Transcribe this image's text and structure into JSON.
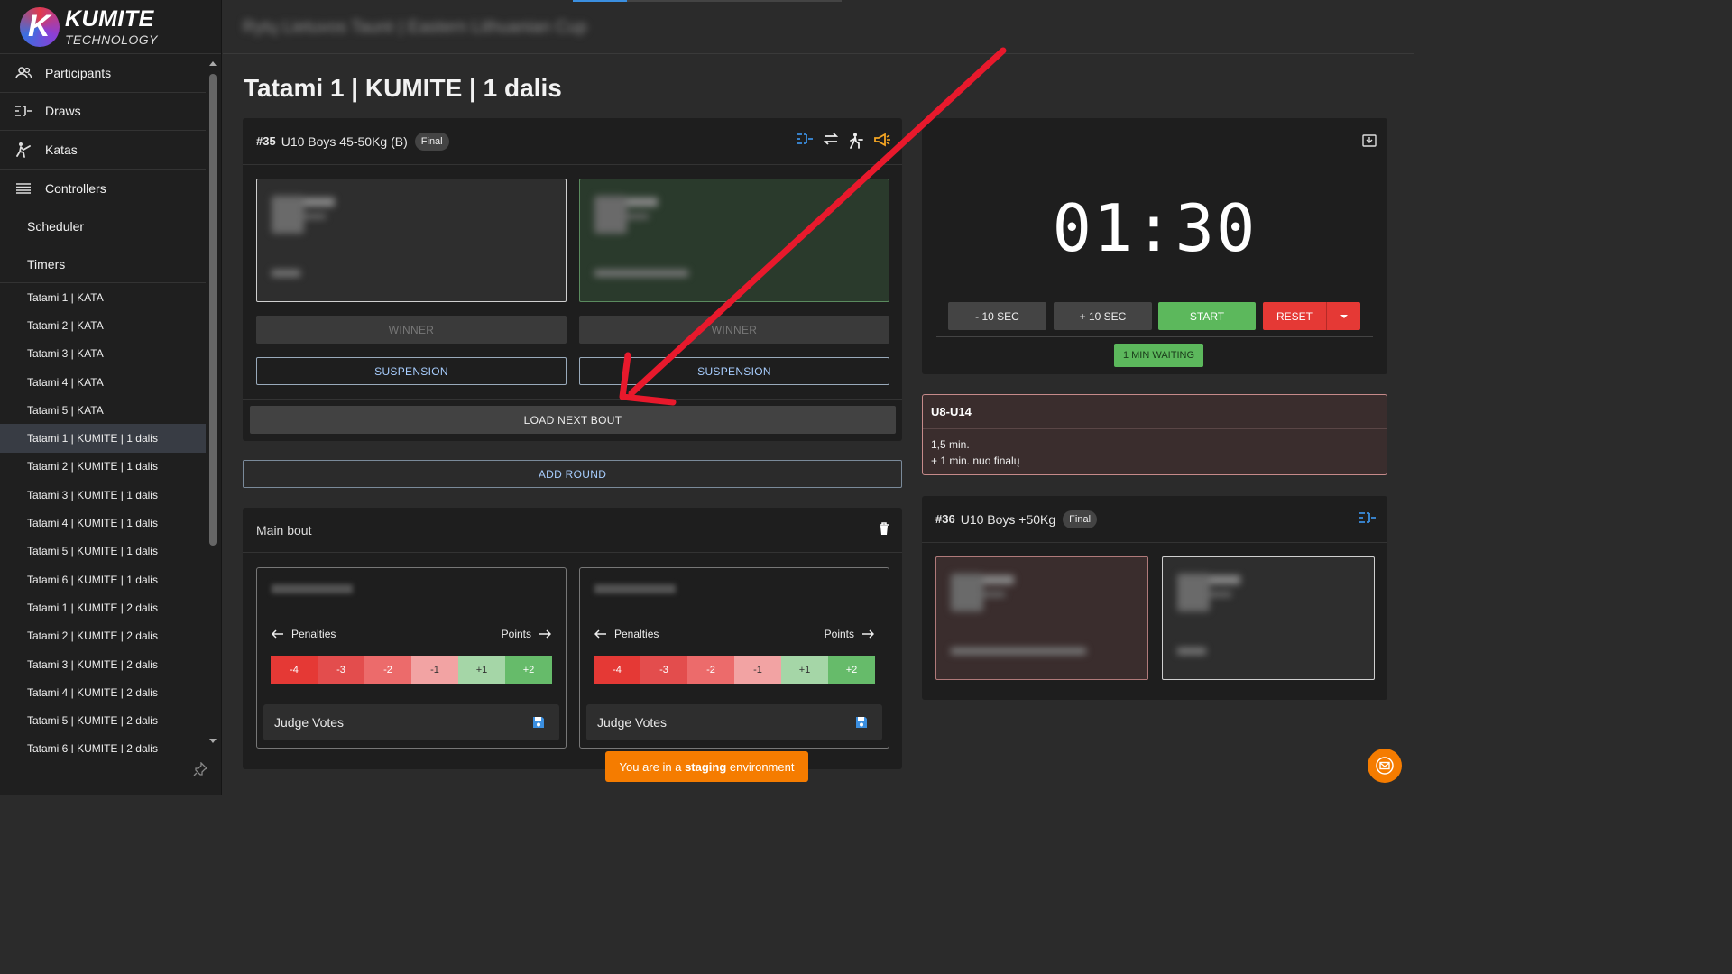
{
  "logo": {
    "title": "KUMITE",
    "subtitle": "TECHNOLOGY"
  },
  "sidebar": {
    "main_items": [
      {
        "label": "Participants",
        "icon": "users-icon"
      },
      {
        "label": "Draws",
        "icon": "bracket-icon"
      },
      {
        "label": "Katas",
        "icon": "kick-icon"
      },
      {
        "label": "Controllers",
        "icon": "list-icon"
      }
    ],
    "plain_items": [
      "Scheduler",
      "Timers"
    ],
    "timers": [
      "Tatami 1 | KATA",
      "Tatami 2 | KATA",
      "Tatami 3 | KATA",
      "Tatami 4 | KATA",
      "Tatami 5 | KATA",
      "Tatami 1 | KUMITE | 1 dalis",
      "Tatami 2 | KUMITE | 1 dalis",
      "Tatami 3 | KUMITE | 1 dalis",
      "Tatami 4 | KUMITE | 1 dalis",
      "Tatami 5 | KUMITE | 1 dalis",
      "Tatami 6 | KUMITE | 1 dalis",
      "Tatami 1 | KUMITE | 2 dalis",
      "Tatami 2 | KUMITE | 2 dalis",
      "Tatami 3 | KUMITE | 2 dalis",
      "Tatami 4 | KUMITE | 2 dalis",
      "Tatami 5 | KUMITE | 2 dalis",
      "Tatami 6 | KUMITE | 2 dalis"
    ],
    "active_timer_index": 5
  },
  "topbar": {
    "tournament_title": "Rytų Lietuvos Taurė | Eastern Lithuanian Cup"
  },
  "page_title": "Tatami 1 | KUMITE | 1 dalis",
  "current_bout": {
    "number": "#35",
    "category": "U10 Boys 45-50Kg (B)",
    "stage": "Final",
    "winner_label": "WINNER",
    "suspension_label": "SUSPENSION",
    "load_next_label": "LOAD NEXT BOUT"
  },
  "add_round_label": "ADD ROUND",
  "main_bout": {
    "title": "Main bout",
    "penalties_label": "Penalties",
    "points_label": "Points",
    "score_buttons": [
      "-4",
      "-3",
      "-2",
      "-1",
      "+1",
      "+2"
    ],
    "score_colors": [
      "#e53935",
      "#e34d4d",
      "#ec6b6b",
      "#f2a3a3",
      "#a5d6a7",
      "#66bb6a"
    ],
    "judge_votes_label": "Judge Votes"
  },
  "timer": {
    "display": "01:30",
    "minus_label": "- 10 SEC",
    "plus_label": "+ 10 SEC",
    "start_label": "START",
    "reset_label": "RESET",
    "waiting_label": "1 MIN WAITING"
  },
  "info": {
    "title": "U8-U14",
    "line1": "1,5 min.",
    "line2": "+ 1 min. nuo finalų"
  },
  "next_bout": {
    "number": "#36",
    "category": "U10 Boys +50Kg",
    "stage": "Final"
  },
  "staging": {
    "prefix": "You are in a ",
    "highlight": "staging",
    "suffix": " environment"
  },
  "colors": {
    "accent_blue": "#3b8fe0",
    "start_green": "#5cb85c",
    "reset_red": "#e53935",
    "staging_orange": "#f57c00",
    "annotation_arrow": "#e8192c"
  }
}
